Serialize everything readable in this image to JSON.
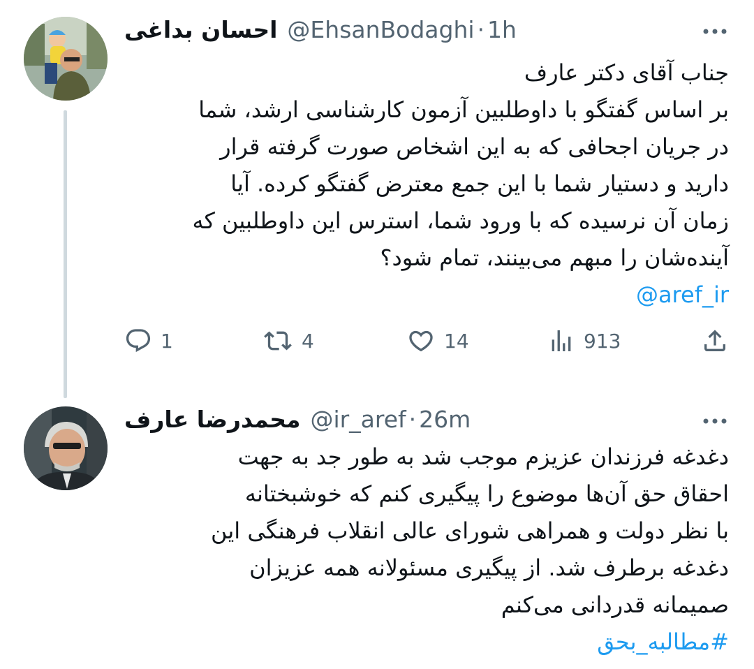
{
  "tweets": [
    {
      "name": "احسان بداغی",
      "handle": "@EhsanBodaghi",
      "time": "1h",
      "body_lines": [
        "جناب آقای دکتر عارف",
        "بر اساس گفتگو با داوطلبین آزمون کارشناسی ارشد، شما",
        "در جریان اجحافی که به این اشخاص صورت گرفته قرار",
        "دارید و دستیار شما با این جمع معترض گفتگو کرده. آیا",
        "زمان آن نرسیده که با ورود شما، استرس این داوطلبین که",
        "آینده‌شان را مبهم می‌بینند، تمام شود؟"
      ],
      "mention": "@aref_ir",
      "stats": {
        "replies": "1",
        "retweets": "4",
        "likes": "14",
        "views": "913"
      },
      "icons": [
        "reply-icon",
        "retweet-icon",
        "like-icon",
        "views-icon",
        "share-icon",
        "more-icon"
      ]
    },
    {
      "name": "محمدرضا عارف",
      "handle": "@ir_aref",
      "time": "26m",
      "body_lines": [
        "دغدغه فرزندان عزیزم موجب شد به طور جد به جهت",
        "احقاق حق آن‌ها موضوع را پیگیری کنم که خوشبختانه",
        "با نظر دولت و همراهی شورای عالی انقلاب فرهنگی این",
        "دغدغه برطرف شد. از پیگیری مسئولانه همه عزیزان",
        "صمیمانه قدردانی می‌کنم"
      ],
      "hashtag": "#مطالبه_بحق"
    }
  ],
  "separator": "·",
  "colors": {
    "link": "#1d9bf0",
    "secondary": "#536471",
    "thread_line": "#cfd9de"
  }
}
